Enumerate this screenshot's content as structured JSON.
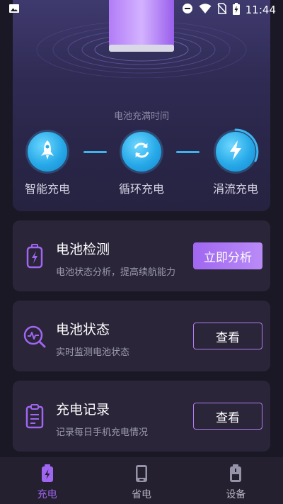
{
  "status_bar": {
    "time": "11:44",
    "icons": [
      "image-icon",
      "dnd-icon",
      "wifi-icon",
      "no-sim-icon",
      "battery-charging-icon"
    ]
  },
  "hero": {
    "full_time_label": "电池充满时间",
    "modes": [
      {
        "label": "智能充电",
        "icon": "rocket-icon"
      },
      {
        "label": "循环充电",
        "icon": "cycle-icon"
      },
      {
        "label": "涓流充电",
        "icon": "lightning-icon",
        "active": true
      }
    ]
  },
  "cards": [
    {
      "title": "电池检测",
      "subtitle": "电池状态分析，提高续航能力",
      "button": "立即分析",
      "icon": "battery-check-icon"
    },
    {
      "title": "电池状态",
      "subtitle": "实时监测电池状态",
      "button": "查看",
      "icon": "monitor-search-icon"
    },
    {
      "title": "充电记录",
      "subtitle": "记录每日手机充电情况",
      "button": "查看",
      "icon": "clipboard-icon"
    }
  ],
  "nav": [
    {
      "label": "充电",
      "icon": "charge-icon",
      "active": true
    },
    {
      "label": "省电",
      "icon": "phone-icon"
    },
    {
      "label": "设备",
      "icon": "device-battery-icon"
    }
  ],
  "colors": {
    "background": "#1b1826",
    "card": "#2a2538",
    "accent_purple": "#a066f2",
    "accent_blue": "#27a9e8"
  }
}
